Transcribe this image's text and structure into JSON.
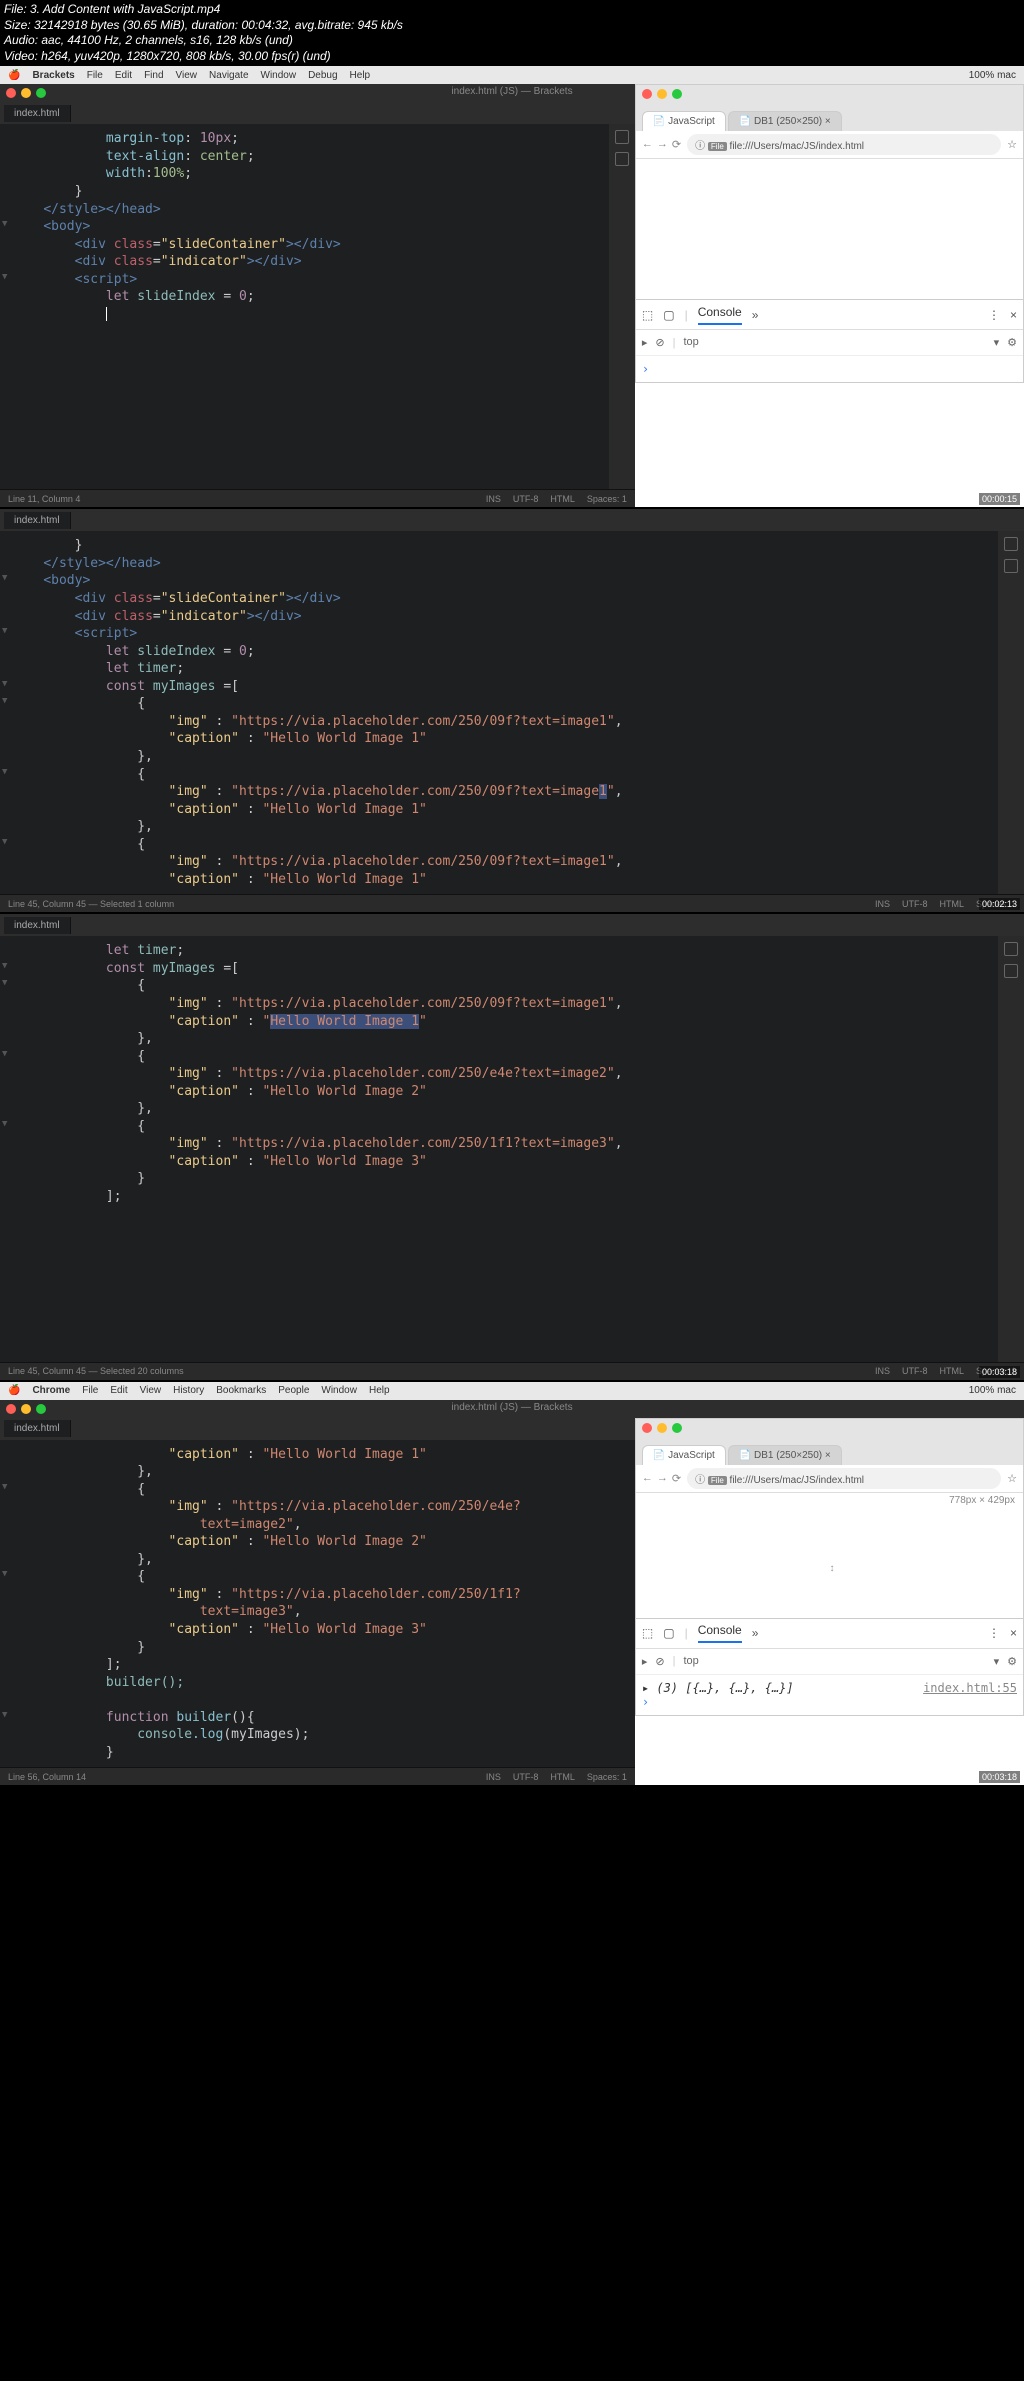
{
  "file_info": {
    "file": "File: 3. Add Content with JavaScript.mp4",
    "size": "Size: 32142918 bytes (30.65 MiB), duration: 00:04:32, avg.bitrate: 945 kb/s",
    "audio": "Audio: aac, 44100 Hz, 2 channels, s16, 128 kb/s (und)",
    "video": "Video: h264, yuv420p, 1280x720, 808 kb/s, 30.00 fps(r) (und)"
  },
  "mac_menu": {
    "app": "Brackets",
    "items": [
      "File",
      "Edit",
      "Find",
      "View",
      "Navigate",
      "Window",
      "Debug",
      "Help"
    ],
    "chrome_app": "Chrome",
    "chrome_items": [
      "File",
      "Edit",
      "View",
      "History",
      "Bookmarks",
      "People",
      "Window",
      "Help"
    ],
    "right": "100%  mac"
  },
  "editor": {
    "tab": "index.html",
    "title": "index.html (JS) — Brackets"
  },
  "panel1": {
    "lines": {
      "l1p": "margin-top",
      "l1v": "10px",
      "l2p": "text-align",
      "l2v": "center",
      "l3p": "width",
      "l3v": "100%",
      "close_brace": "}",
      "style_close": "</style></head>",
      "body_open": "<body>",
      "div1a": "<div class=",
      "div1b": "\"slideContainer\"",
      "div1c": "></div>",
      "div2a": "<div class=",
      "div2b": "\"indicator\"",
      "div2c": "></div>",
      "script_open": "<script>",
      "let1": "let slideIndex = 0;",
      "let1_kw": "let",
      "let1_id": "slideIndex",
      "let1_eq": " = ",
      "let1_v": "0",
      "let1_sc": ";"
    },
    "status": "Line 11, Column 4",
    "status_right": [
      "INS",
      "UTF-8",
      "HTML",
      "Spaces: 1"
    ],
    "timestamp": "00:00:15"
  },
  "panel2": {
    "lines": {
      "brace": "}",
      "style_close": "</style></head>",
      "body": "<body>",
      "div1": "<div class=\"slideContainer\"></div>",
      "div2": "<div class=\"indicator\"></div>",
      "script": "<script>",
      "let1": "let slideIndex = 0;",
      "let2": "let timer;",
      "const1": "const myImages =[",
      "obj_open": "{",
      "img_k": "\"img\"",
      "img_v1": "\"https://via.placeholder.com/250/09f?text=image1\"",
      "cap_k": "\"caption\"",
      "cap_v": "\"Hello World Image 1\"",
      "obj_close": "},"
    },
    "status": "Line 45, Column 45 — Selected 1 column",
    "timestamp": "00:02:13"
  },
  "panel3": {
    "lines": {
      "let2": "let timer;",
      "const1": "const myImages =[",
      "img_v2": "\"https://via.placeholder.com/250/e4e?text=image2\"",
      "cap_v2": "\"Hello World Image 2\"",
      "img_v3": "\"https://via.placeholder.com/250/1f1?text=image3\"",
      "cap_v3": "\"Hello World Image 3\"",
      "arr_close": "];"
    },
    "status": "Line 45, Column 45 — Selected 20 columns",
    "timestamp": "00:03:18"
  },
  "panel4": {
    "lines": {
      "cap_v1": "\"Hello World Image 1\"",
      "img_v2a": "\"https://via.placeholder.com/250/e4e?",
      "img_v2b": "text=image2\"",
      "cap_v2": "\"Hello World Image 2\"",
      "img_v3a": "\"https://via.placeholder.com/250/1f1?",
      "img_v3b": "text=image3\"",
      "cap_v3": "\"Hello World Image 3\"",
      "arr_close": "];",
      "builder_call": "builder();",
      "fn_kw": "function",
      "fn_name": "builder",
      "fn_sig": "(){",
      "console": "console",
      "log": ".log",
      "log_arg": "(myImages);",
      "close": "}"
    },
    "status": "Line 56, Column 14",
    "timestamp": "00:03:18"
  },
  "browser": {
    "tab1": "JavaScript",
    "tab2": "DB1 (250×250)",
    "tab2_close": "×",
    "url": "file:///Users/mac/JS/index.html",
    "file_badge": "File",
    "dims": "778px × 429px"
  },
  "devtools": {
    "tab_console": "Console",
    "chevrons": "»",
    "more": "⋮",
    "close": "×",
    "filter_top": "top",
    "prompt": "›",
    "output_tri": "▸",
    "output": "(3) [{…}, {…}, {…}]",
    "link": "index.html:55"
  }
}
